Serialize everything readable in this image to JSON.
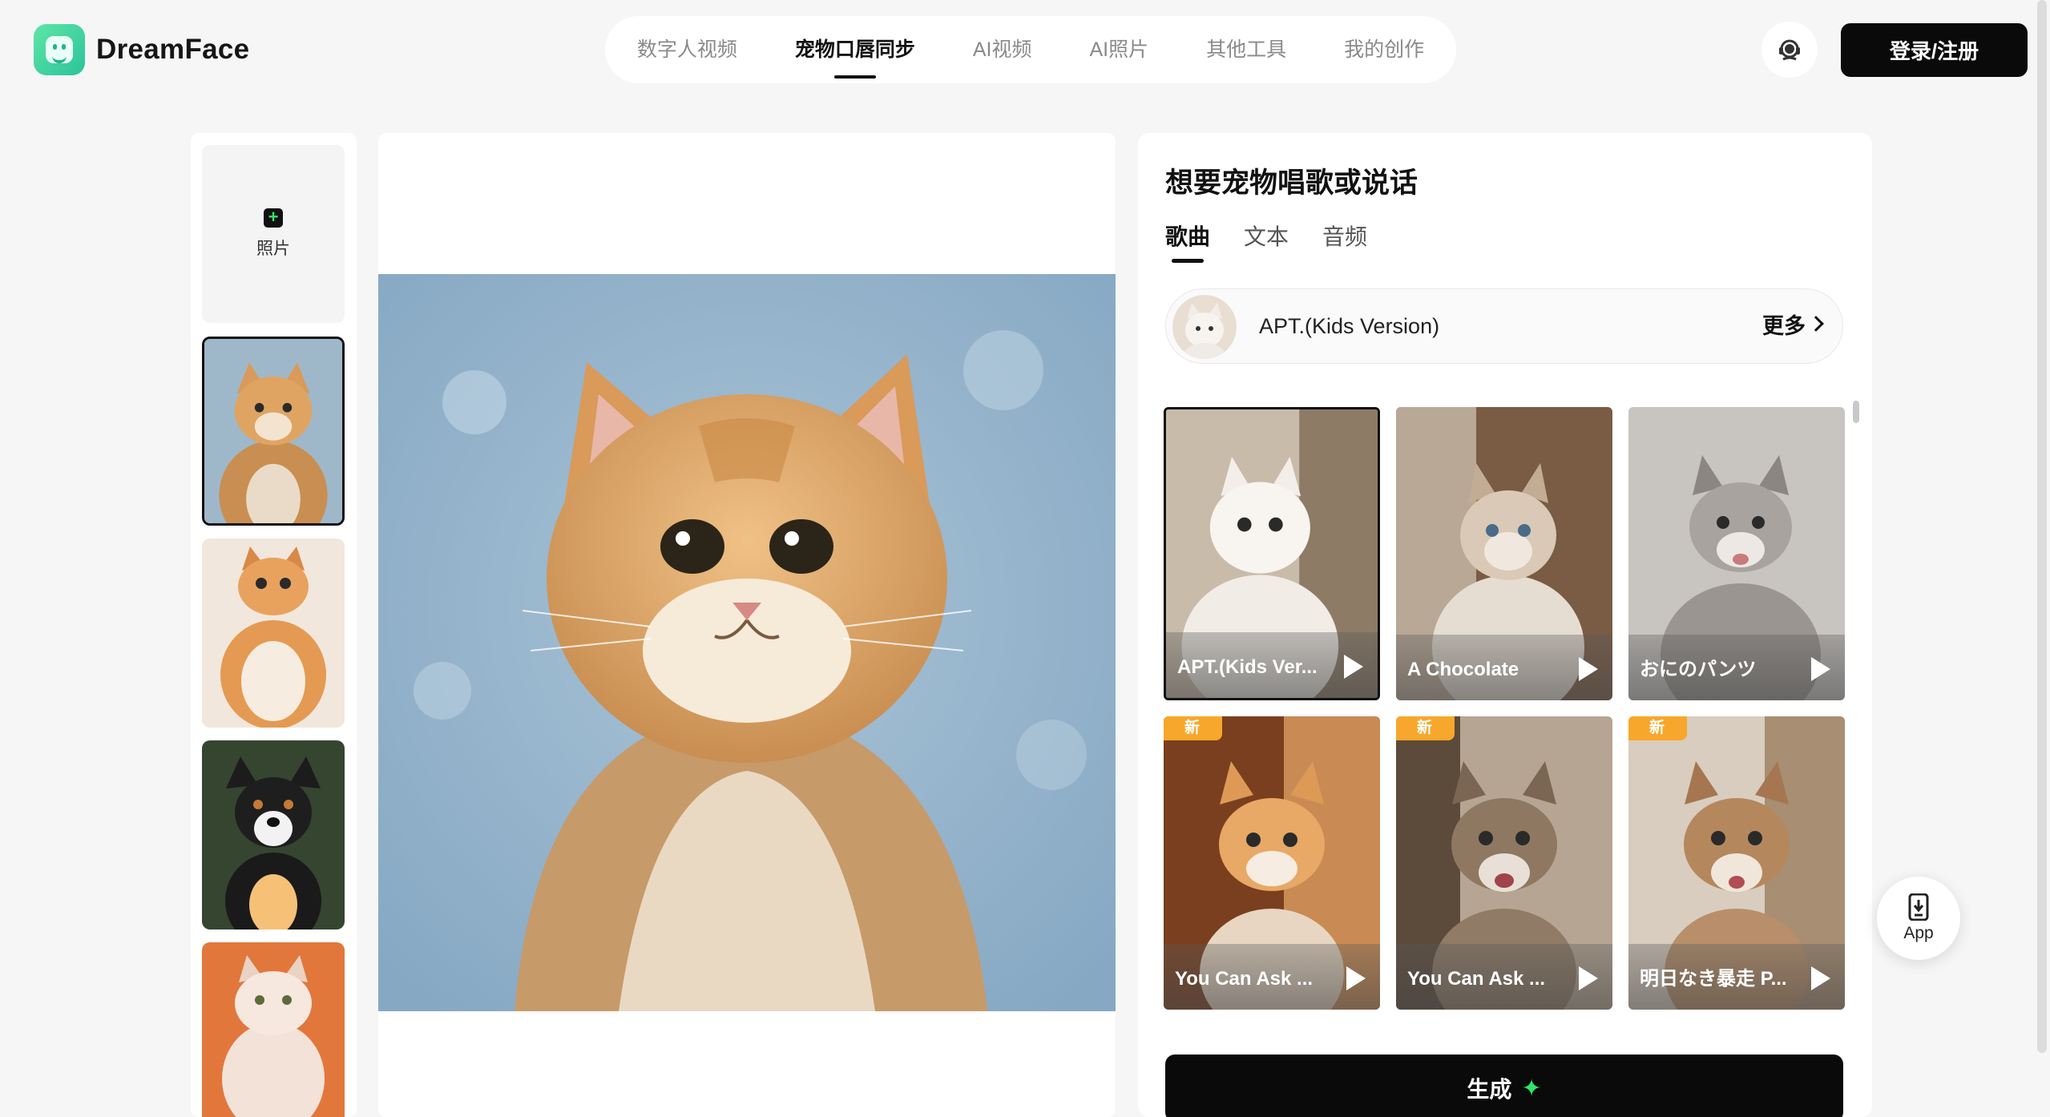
{
  "brand": {
    "name": "DreamFace"
  },
  "nav": {
    "items": [
      {
        "label": "数字人视频",
        "active": false
      },
      {
        "label": "宠物口唇同步",
        "active": true
      },
      {
        "label": "AI视频",
        "active": false
      },
      {
        "label": "AI照片",
        "active": false
      },
      {
        "label": "其他工具",
        "active": false
      },
      {
        "label": "我的创作",
        "active": false
      }
    ]
  },
  "header": {
    "support_icon": "headset-icon",
    "login_label": "登录/注册"
  },
  "left": {
    "upload_label": "照片",
    "thumbnails": [
      {
        "subject": "orange-white cat",
        "selected": true
      },
      {
        "subject": "chubby orange cat",
        "selected": false
      },
      {
        "subject": "black tricolor puppy",
        "selected": false
      },
      {
        "subject": "fluffy white cat on orange",
        "selected": false
      }
    ]
  },
  "panel": {
    "title": "想要宠物唱歌或说话",
    "tabs": [
      {
        "label": "歌曲",
        "active": true
      },
      {
        "label": "文本",
        "active": false
      },
      {
        "label": "音频",
        "active": false
      }
    ],
    "current_song": "APT.(Kids Version)",
    "more_label": "更多",
    "new_badge": "新",
    "songs": [
      {
        "label": "APT.(Kids Ver...",
        "is_new": false,
        "selected": true
      },
      {
        "label": "A Chocolate",
        "is_new": false,
        "selected": false
      },
      {
        "label": "おにのパンツ",
        "is_new": false,
        "selected": false
      },
      {
        "label": "You Can Ask ...",
        "is_new": true,
        "selected": false
      },
      {
        "label": "You Can Ask ...",
        "is_new": true,
        "selected": false
      },
      {
        "label": "明日なき暴走 P...",
        "is_new": true,
        "selected": false
      }
    ],
    "generate_label": "生成"
  },
  "app_button": {
    "label": "App"
  },
  "colors": {
    "accent_green": "#2fe56a",
    "badge_orange": "#f7a72b",
    "primary_black": "#0a0a0a"
  }
}
